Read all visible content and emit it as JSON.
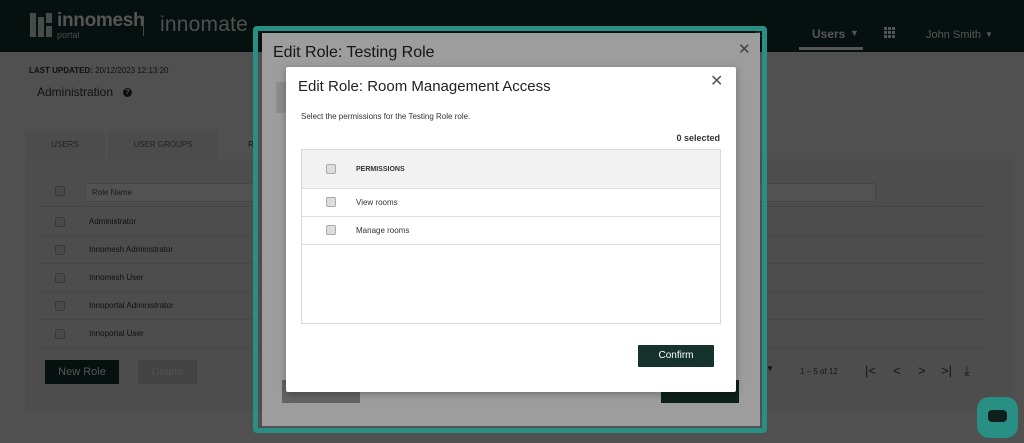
{
  "header": {
    "brand_name": "innomesh",
    "brand_sub": "portal",
    "brand_secondary": "innomate",
    "nav_hidden": "s",
    "nav_users": "Users",
    "user_name": "John Smith"
  },
  "page": {
    "last_updated_label": "LAST UPDATED:",
    "last_updated_value": "20/12/2023 12:13:20",
    "title": "Administration"
  },
  "tabs": [
    {
      "label": "USERS"
    },
    {
      "label": "USER GROUPS"
    },
    {
      "label": "R"
    }
  ],
  "roles_table": {
    "column_header": "Role Name",
    "rows": [
      {
        "name": "Administrator"
      },
      {
        "name": "Innomesh Administrator"
      },
      {
        "name": "Innomesh User"
      },
      {
        "name": "Innoportal Administrator"
      },
      {
        "name": "Innoportal User"
      }
    ]
  },
  "actions": {
    "new_role": "New Role",
    "delete": "Delete"
  },
  "pagination": {
    "range": "1 – 5 of 12"
  },
  "dialog_outer": {
    "title": "Edit Role: Testing Role"
  },
  "dialog": {
    "title": "Edit Role: Room Management Access",
    "description": "Select the permissions for the Testing Role role.",
    "selected_count": "0 selected",
    "column_header": "PERMISSIONS",
    "permissions": [
      {
        "label": "View rooms",
        "checked": false
      },
      {
        "label": "Manage rooms",
        "checked": false
      }
    ],
    "confirm_label": "Confirm"
  },
  "colors": {
    "brand_dark": "#15332c",
    "accent": "#40e0d0"
  },
  "icons": {
    "help": "help-circle-icon",
    "close": "close-icon",
    "apps": "grid-icon",
    "chat": "chat-icon"
  }
}
